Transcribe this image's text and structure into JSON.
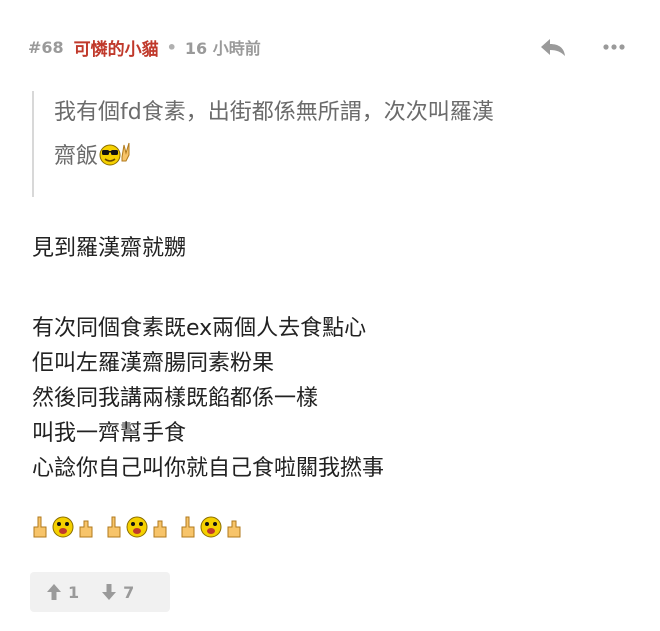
{
  "post": {
    "number": "#68",
    "username": "可憐的小貓",
    "separator": "•",
    "time": "16 小時前"
  },
  "quote": {
    "line1": "我有個fd食素，出街都係無所謂，次次叫羅漢",
    "line2": "齋飯"
  },
  "body": {
    "line1": "見到羅漢齋就嬲",
    "paragraph": [
      "有次同個食素既ex兩個人去食點心",
      "佢叫左羅漢齋腸同素粉果",
      "然後同我講兩樣既餡都係一樣",
      "叫我一齊幫手食",
      "心諗你自己叫你就自己食啦關我撚事"
    ]
  },
  "votes": {
    "up": "1",
    "down": "7"
  },
  "colors": {
    "username": "#c0392b",
    "meta": "#9a9a9a",
    "quote_text": "#6b6b6b",
    "body_text": "#222222",
    "vote_bg": "#f1f1f1"
  }
}
